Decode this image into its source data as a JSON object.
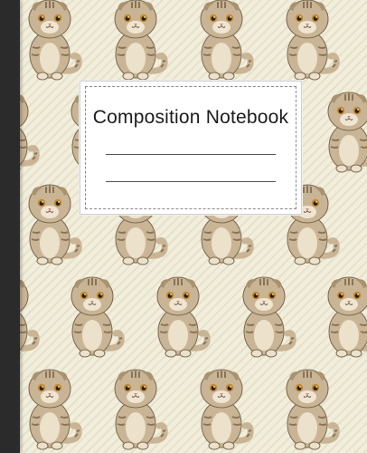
{
  "cover": {
    "title": "Composition Notebook",
    "pattern_motif": "scottish-fold-cat-icon",
    "colors": {
      "background": "#f2eedc",
      "spine": "#2b2b2b",
      "label": "#ffffff",
      "cat_fur": "#c9b595",
      "cat_stripes": "#8a7457",
      "cat_eyes": "#c48a2e"
    }
  }
}
